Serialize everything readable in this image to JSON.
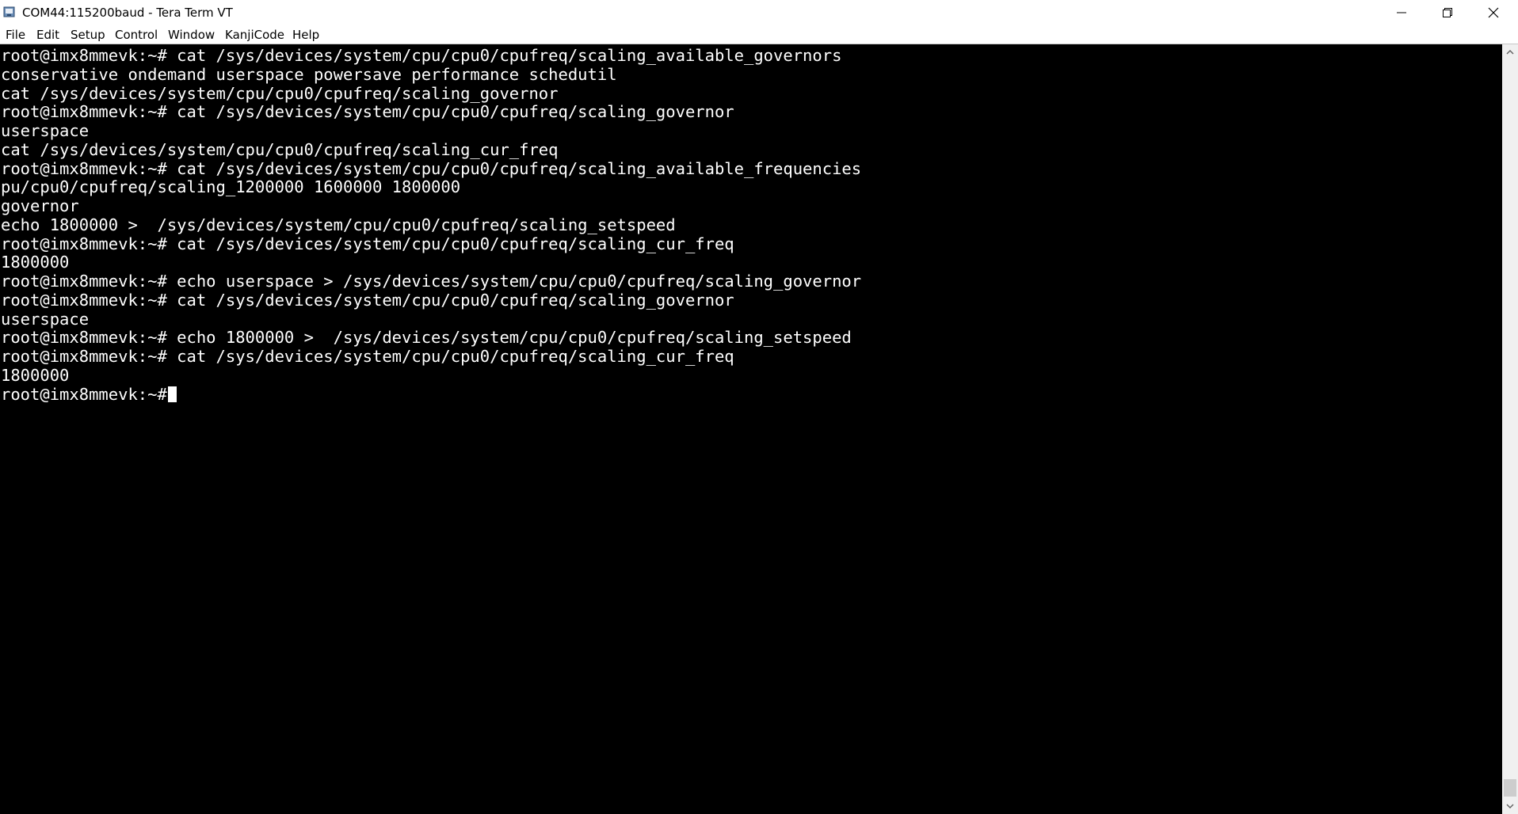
{
  "window": {
    "title": "COM44:115200baud - Tera Term VT"
  },
  "menu": [
    {
      "label": "File"
    },
    {
      "label": "Edit"
    },
    {
      "label": "Setup"
    },
    {
      "label": "Control"
    },
    {
      "label": "Window"
    },
    {
      "label": "KanjiCode"
    },
    {
      "label": "Help"
    }
  ],
  "terminal": {
    "lines": [
      "root@imx8mmevk:~# cat /sys/devices/system/cpu/cpu0/cpufreq/scaling_available_governors",
      "conservative ondemand userspace powersave performance schedutil",
      "cat /sys/devices/system/cpu/cpu0/cpufreq/scaling_governor",
      "root@imx8mmevk:~# cat /sys/devices/system/cpu/cpu0/cpufreq/scaling_governor",
      "userspace",
      "cat /sys/devices/system/cpu/cpu0/cpufreq/scaling_cur_freq",
      "root@imx8mmevk:~# cat /sys/devices/system/cpu/cpu0/cpufreq/scaling_available_frequencies",
      "pu/cpu0/cpufreq/scaling_1200000 1600000 1800000",
      "governor",
      "echo 1800000 >  /sys/devices/system/cpu/cpu0/cpufreq/scaling_setspeed",
      "root@imx8mmevk:~# cat /sys/devices/system/cpu/cpu0/cpufreq/scaling_cur_freq",
      "1800000",
      "root@imx8mmevk:~# echo userspace > /sys/devices/system/cpu/cpu0/cpufreq/scaling_governor",
      "root@imx8mmevk:~# cat /sys/devices/system/cpu/cpu0/cpufreq/scaling_governor",
      "userspace",
      "root@imx8mmevk:~# echo 1800000 >  /sys/devices/system/cpu/cpu0/cpufreq/scaling_setspeed",
      "root@imx8mmevk:~# cat /sys/devices/system/cpu/cpu0/cpufreq/scaling_cur_freq",
      "1800000",
      "root@imx8mmevk:~#"
    ],
    "foreground": "#ffffff",
    "background": "#000000"
  },
  "icons": {
    "app": "tera-term-icon",
    "minimize": "minimize-icon",
    "maximize": "restore-icon",
    "close": "close-icon",
    "scroll_up": "chevron-up-icon",
    "scroll_down": "chevron-down-icon"
  }
}
